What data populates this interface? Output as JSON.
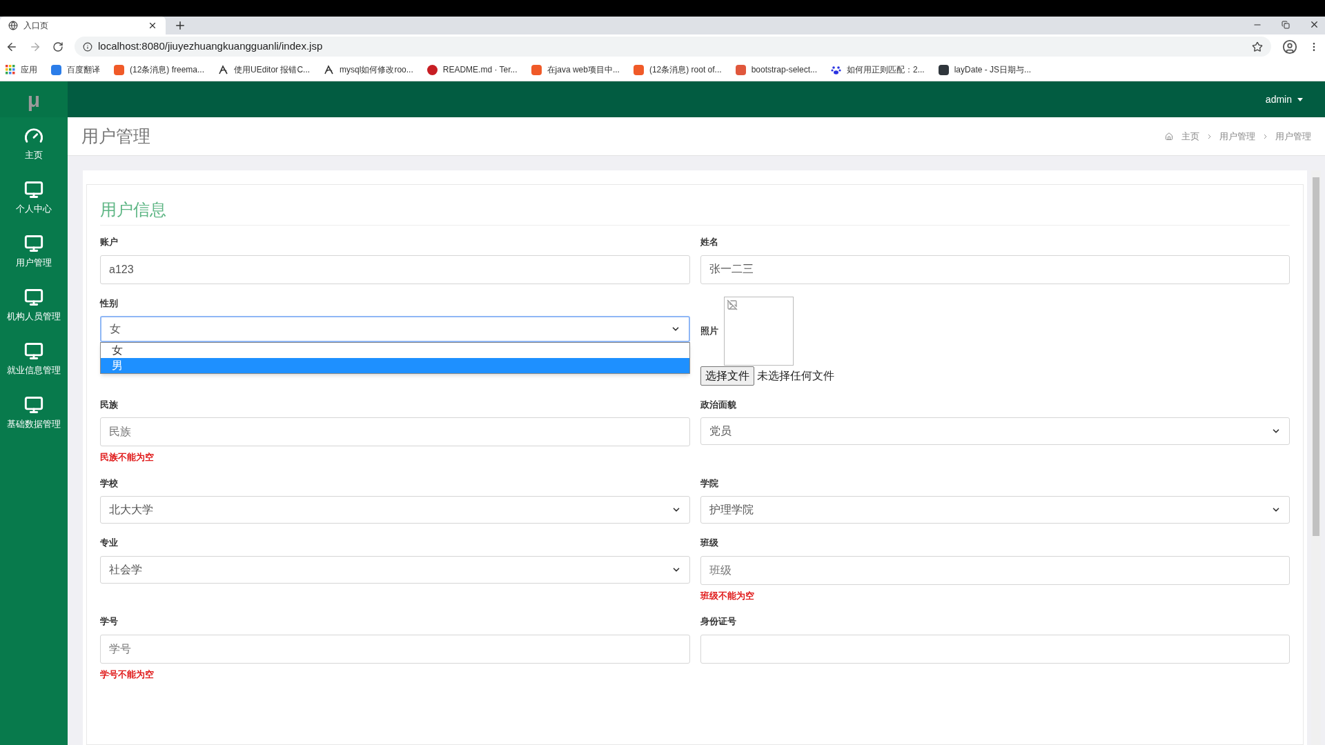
{
  "browser": {
    "tab_title": "入口页",
    "url": "localhost:8080/jiuyezhuangkuangguanli/index.jsp",
    "bookmarks": [
      {
        "label": "应用",
        "kind": "apps"
      },
      {
        "label": "百度翻译",
        "kind": "translate"
      },
      {
        "label": "(12条消息) freema...",
        "kind": "c"
      },
      {
        "label": "使用UEditor 报错C...",
        "kind": "swirl"
      },
      {
        "label": "mysql如何修改roo...",
        "kind": "swirl"
      },
      {
        "label": "README.md · Ter...",
        "kind": "g"
      },
      {
        "label": "在java web项目中...",
        "kind": "c"
      },
      {
        "label": "(12条消息) root of...",
        "kind": "c"
      },
      {
        "label": "bootstrap-select...",
        "kind": "jian"
      },
      {
        "label": "如何用正则匹配：2...",
        "kind": "paw"
      },
      {
        "label": "layDate - JS日期与...",
        "kind": "lay"
      }
    ]
  },
  "app": {
    "logo": "μ",
    "user": "admin",
    "sidebar": [
      {
        "label": "主页",
        "kind": "dashboard"
      },
      {
        "label": "个人中心",
        "kind": "monitor"
      },
      {
        "label": "用户管理",
        "kind": "monitor"
      },
      {
        "label": "机构人员管理",
        "kind": "monitor"
      },
      {
        "label": "就业信息管理",
        "kind": "monitor"
      },
      {
        "label": "基础数据管理",
        "kind": "monitor"
      }
    ],
    "page_title": "用户管理",
    "breadcrumb": [
      "主页",
      "用户管理",
      "用户管理"
    ],
    "card_title": "用户信息",
    "fields": [
      {
        "label": "账户",
        "kind": "input",
        "value": "a123"
      },
      {
        "label": "姓名",
        "kind": "input",
        "value": "张一二三"
      },
      {
        "label": "性别",
        "kind": "select",
        "value": "女",
        "expanded": true,
        "options": [
          {
            "label": "女",
            "highlighted": false
          },
          {
            "label": "男",
            "highlighted": true
          }
        ]
      },
      {
        "label": "照片",
        "kind": "file",
        "button": "选择文件",
        "status": "未选择任何文件"
      },
      {
        "label": "民族",
        "kind": "input",
        "placeholder": "民族",
        "error": "民族不能为空"
      },
      {
        "label": "政治面貌",
        "kind": "select",
        "value": "党员",
        "expanded": false
      },
      {
        "label": "学校",
        "kind": "select",
        "value": "北大大学",
        "expanded": false
      },
      {
        "label": "学院",
        "kind": "select",
        "value": "护理学院",
        "expanded": false
      },
      {
        "label": "专业",
        "kind": "select",
        "value": "社会学",
        "expanded": false
      },
      {
        "label": "班级",
        "kind": "input",
        "placeholder": "班级",
        "error": "班级不能为空"
      },
      {
        "label": "学号",
        "kind": "input",
        "placeholder": "学号",
        "error": "学号不能为空"
      },
      {
        "label": "身份证号",
        "kind": "input"
      }
    ]
  }
}
